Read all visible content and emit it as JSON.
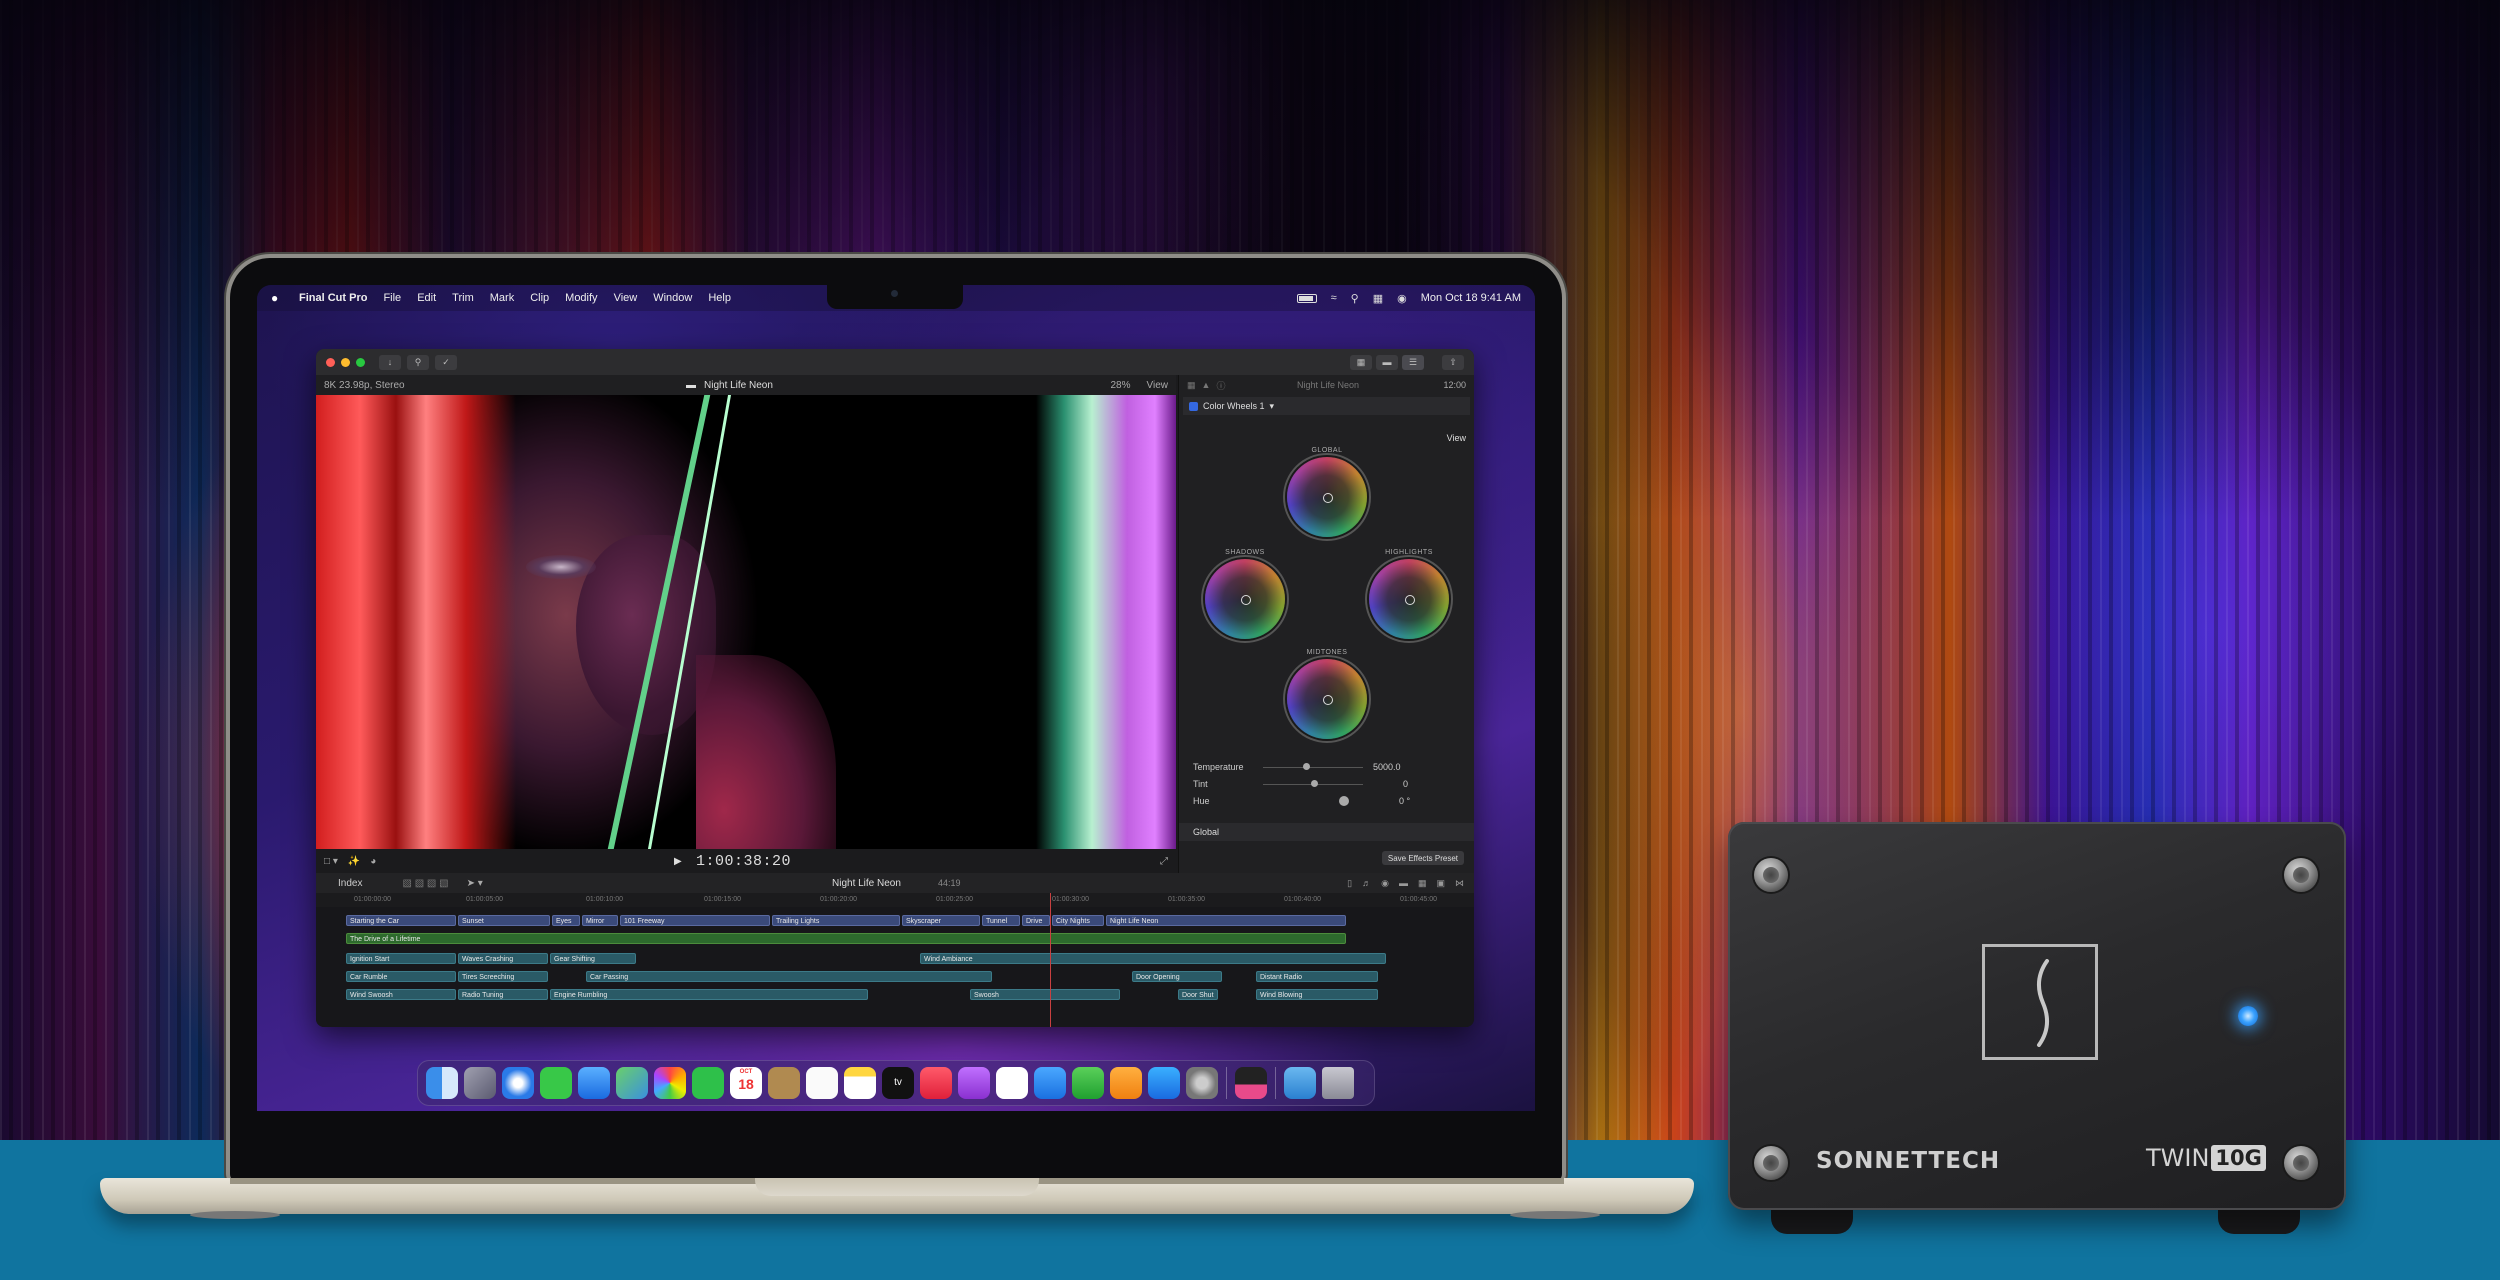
{
  "menubar": {
    "app": "Final Cut Pro",
    "items": [
      "File",
      "Edit",
      "Trim",
      "Mark",
      "Clip",
      "Modify",
      "View",
      "Window",
      "Help"
    ],
    "datetime": "Mon Oct 18  9:41 AM"
  },
  "viewer": {
    "format": "8K 23.98p, Stereo",
    "title": "Night Life Neon",
    "zoom": "28%",
    "view_label": "View",
    "timecode": "1:00:38:20"
  },
  "inspector": {
    "clip_name": "Night Life Neon",
    "duration": "12:00",
    "effect": "Color Wheels 1",
    "view_label": "View",
    "wheels": {
      "global": "GLOBAL",
      "shadows": "SHADOWS",
      "highlights": "HIGHLIGHTS",
      "midtones": "MIDTONES"
    },
    "params": [
      {
        "label": "Temperature",
        "value": "5000.0"
      },
      {
        "label": "Tint",
        "value": "0"
      },
      {
        "label": "Hue",
        "value": "0 °"
      }
    ],
    "footer": "Global",
    "save_preset": "Save Effects Preset"
  },
  "timeline": {
    "index_label": "Index",
    "project": "Night Life Neon",
    "project_duration": "44:19",
    "ruler": [
      "01:00:00:00",
      "01:00:05:00",
      "01:00:10:00",
      "01:00:15:00",
      "01:00:20:00",
      "01:00:25:00",
      "01:00:30:00",
      "01:00:35:00",
      "01:00:40:00",
      "01:00:45:00"
    ],
    "video_clips": [
      "Starting the Car",
      "Sunset",
      "Eyes",
      "Mirror",
      "101 Freeway",
      "Trailing Lights",
      "Skyscraper",
      "Tunnel",
      "Drive",
      "City Nights",
      "Night Life Neon"
    ],
    "music_clip": "The Drive of a Lifetime",
    "sfx_row1": [
      "Ignition Start",
      "Waves Crashing",
      "Gear Shifting",
      "Wind Ambiance"
    ],
    "sfx_row2": [
      "Car Rumble",
      "Tires Screeching",
      "Car Passing",
      "Door Opening",
      "Distant Radio"
    ],
    "sfx_row3": [
      "Wind Swoosh",
      "Radio Tuning",
      "Engine Rumbling",
      "Swoosh",
      "Door Shut",
      "Wind Blowing"
    ]
  },
  "dock": {
    "calendar_month": "OCT",
    "calendar_day": "18",
    "tv_label": "tv"
  },
  "device": {
    "brand": "SONNETTECH",
    "model_prefix": "TWIN",
    "model_badge": "10G"
  }
}
